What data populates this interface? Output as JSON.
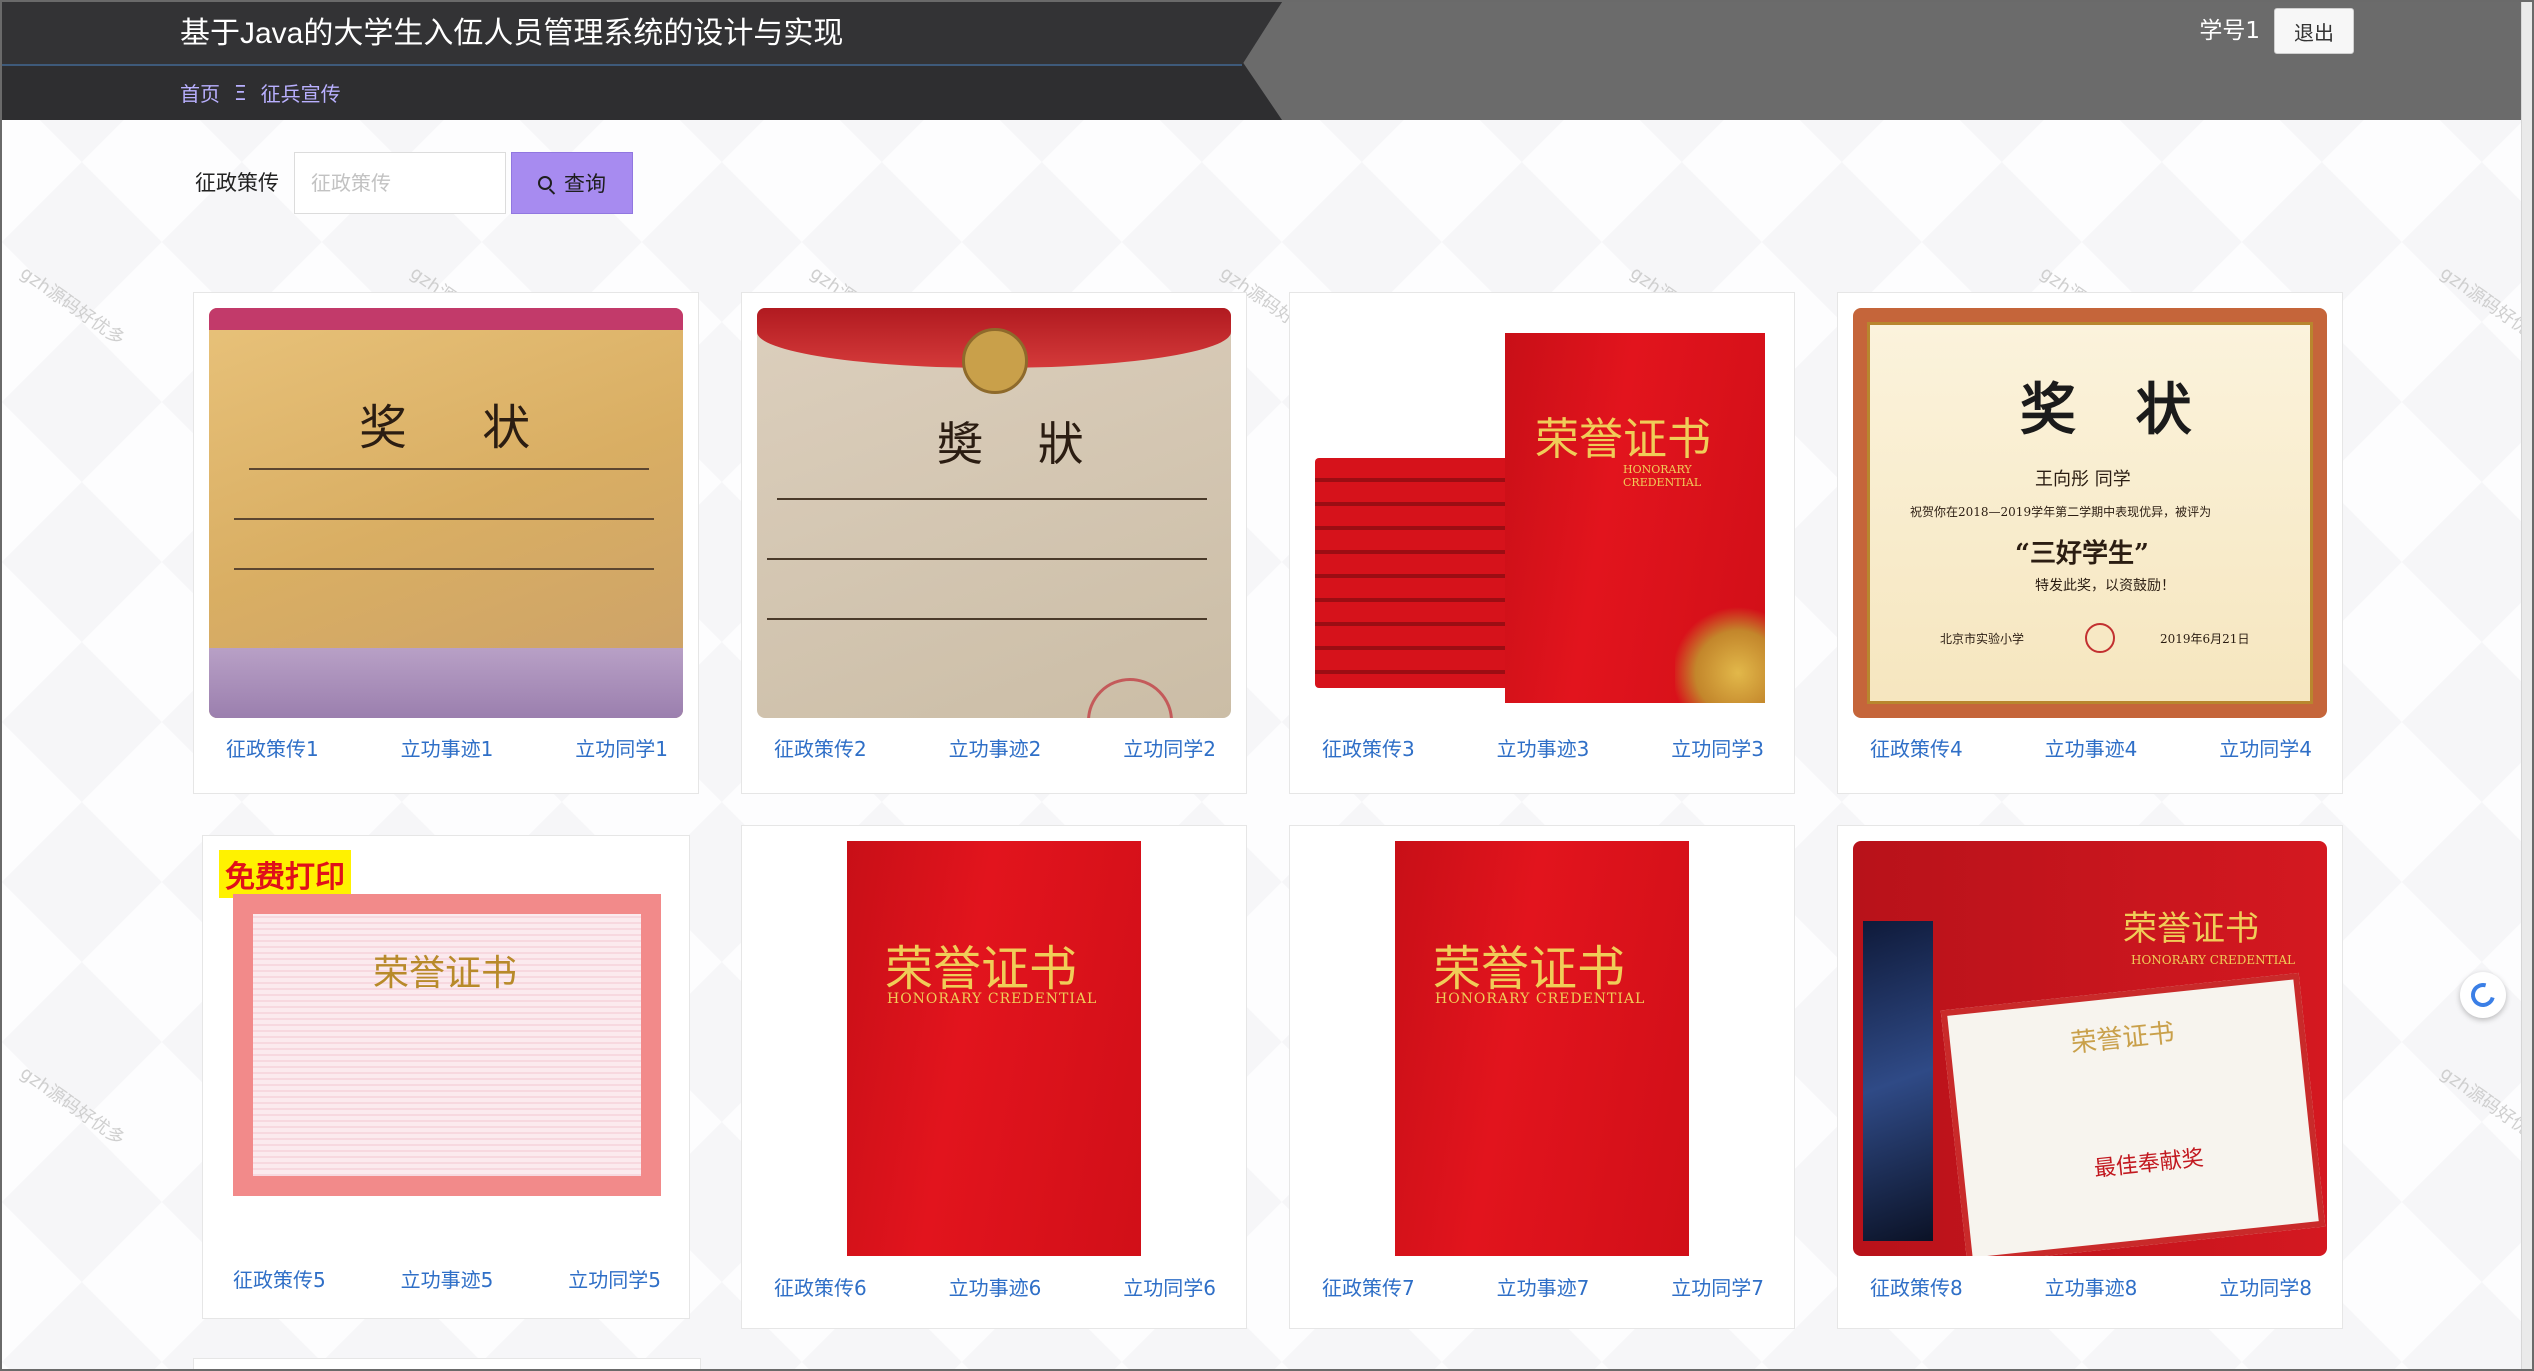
{
  "app": {
    "title": "基于Java的大学生入伍人员管理系统的设计与实现",
    "user": "学号1",
    "logout_label": "退出"
  },
  "breadcrumb": {
    "home": "首页",
    "separator": "Ξ",
    "current": "征兵宣传"
  },
  "search": {
    "label": "征政策传",
    "placeholder": "征政策传",
    "value": "",
    "button_label": "查询"
  },
  "watermark": "gzh源码好优多",
  "cards": [
    {
      "links": [
        "征政策传1",
        "立功事迹1",
        "立功同学1"
      ],
      "image": "award-certificate-handwritten"
    },
    {
      "links": [
        "征政策传2",
        "立功事迹2",
        "立功同学2"
      ],
      "image": "award-certificate-old"
    },
    {
      "links": [
        "征政策传3",
        "立功事迹3",
        "立功同学3"
      ],
      "image": "red-honorary-credential-stack"
    },
    {
      "links": [
        "征政策传4",
        "立功事迹4",
        "立功同学4"
      ],
      "image": "award-certificate-three-good-student"
    },
    {
      "links": [
        "征政策传5",
        "立功事迹5",
        "立功同学5"
      ],
      "image": "pink-honor-certificate"
    },
    {
      "links": [
        "征政策传6",
        "立功事迹6",
        "立功同学6"
      ],
      "image": "red-honorary-credential-cover"
    },
    {
      "links": [
        "征政策传7",
        "立功事迹7",
        "立功同学7"
      ],
      "image": "red-honorary-credential-cover"
    },
    {
      "links": [
        "征政策传8",
        "立功事迹8",
        "立功同学8"
      ],
      "image": "honorary-credential-open"
    }
  ],
  "art": {
    "award": "奖 状",
    "award_old": "奬 狀",
    "honor": "荣誉证书",
    "honor_en": "HONORARY CREDENTIAL",
    "student_name": "王向彤  同学",
    "student_line": "祝贺你在2018—2019学年第二学期中表现优异，被评为",
    "student_title": "“三好学生”",
    "student_note": "特发此奖，以资鼓励！",
    "school": "北京市实验小学",
    "date": "2019年6月21日",
    "free_print": "免费打印",
    "dedication": "最佳奉献奖"
  }
}
